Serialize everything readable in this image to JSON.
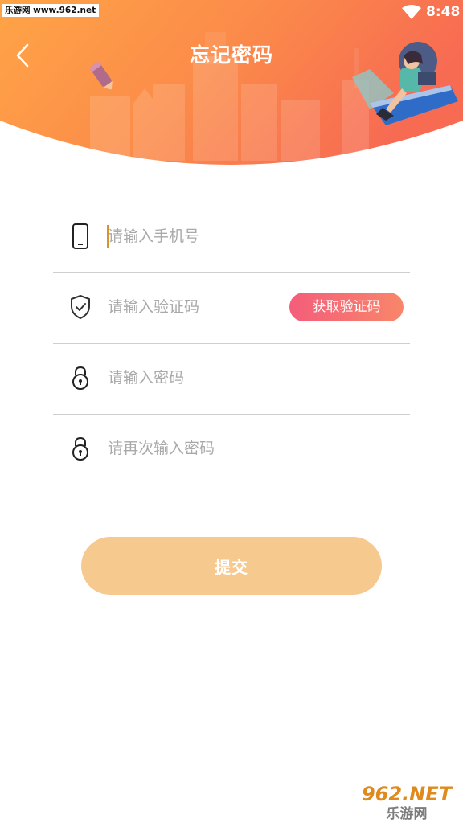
{
  "status_bar": {
    "watermark": "乐游网 www.962.net",
    "time": "8:48",
    "wifi_icon": "wifi-icon"
  },
  "header": {
    "title": "忘记密码",
    "back_icon": "chevron-left-icon",
    "gradient_start": "#ffa84a",
    "gradient_end": "#f86d53"
  },
  "form": {
    "phone": {
      "placeholder": "请输入手机号",
      "icon": "phone-icon"
    },
    "code": {
      "placeholder": "请输入验证码",
      "icon": "shield-check-icon",
      "button_label": "获取验证码"
    },
    "password": {
      "placeholder": "请输入密码",
      "icon": "lock-icon"
    },
    "password_confirm": {
      "placeholder": "请再次输入密码",
      "icon": "lock-icon"
    }
  },
  "submit": {
    "label": "提交",
    "color": "#f6c98f"
  },
  "watermark_logo": {
    "main": "962.NET",
    "sub": "乐游网"
  }
}
